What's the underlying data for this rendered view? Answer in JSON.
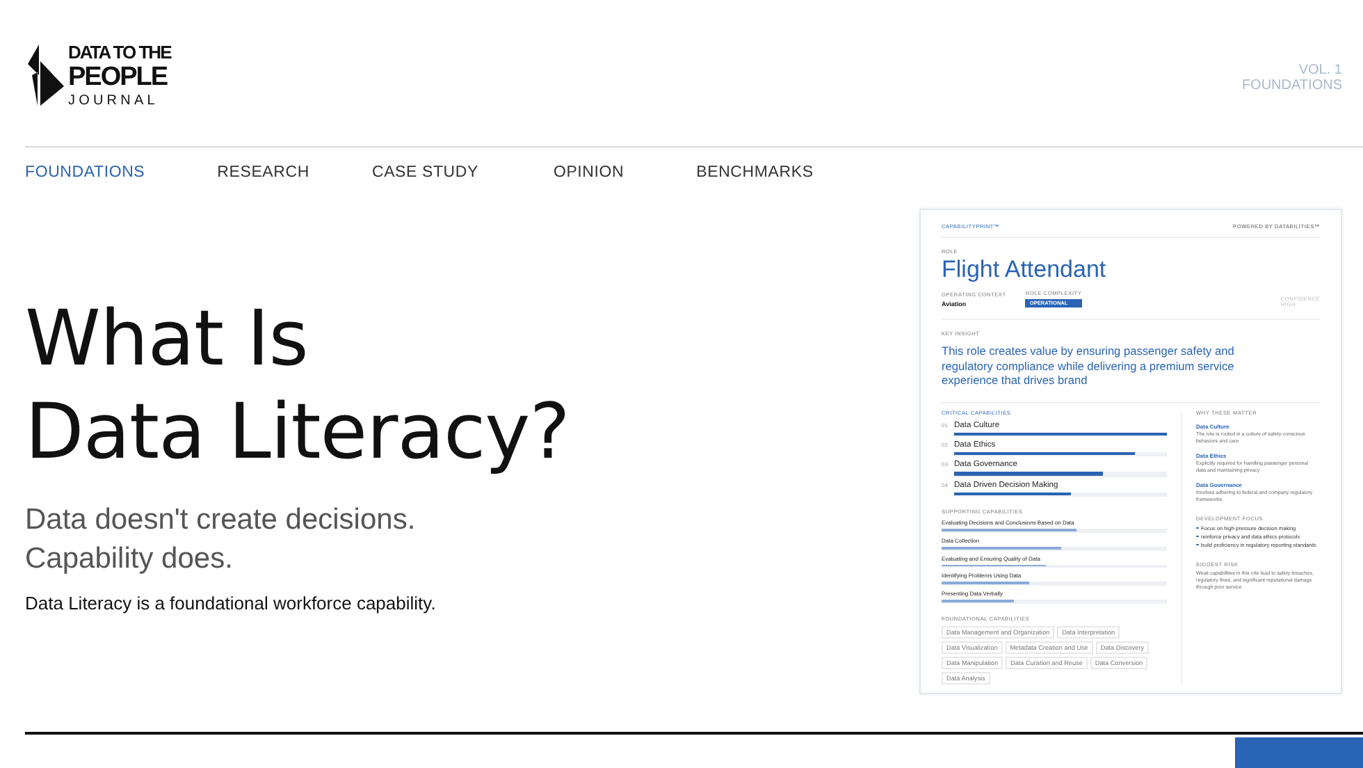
{
  "logo": {
    "line_1": "DATA TO THE",
    "line_2": "PEOPLE",
    "line_3": "JOURNAL"
  },
  "issue": {
    "volume": "VOL. 1",
    "section": "FOUNDATIONS"
  },
  "nav": [
    {
      "label": "FOUNDATIONS",
      "selected": true
    },
    {
      "label": "RESEARCH",
      "selected": false
    },
    {
      "label": "CASE STUDY",
      "selected": false
    },
    {
      "label": "OPINION",
      "selected": false
    },
    {
      "label": "BENCHMARKS",
      "selected": false
    }
  ],
  "hero": {
    "title_lines": [
      "What Is",
      "Data Literacy?"
    ],
    "subtitle_lines": [
      "Data doesn't create decisions.",
      "Capability does."
    ],
    "lead": "Data Literacy is a foundational workforce capability."
  },
  "card": {
    "brand": "CAPABILITYPRINT™",
    "powered_by": "POWERED BY DATABILITIES™",
    "role_label": "ROLE",
    "role": "Flight Attendant",
    "context_label": "OPERATING CONTEXT",
    "context": "Aviation",
    "complexity_label": "ROLE COMPLEXITY",
    "complexity": "OPERATIONAL",
    "confidence_label": "CONFIDENCE",
    "confidence": "HIGH",
    "insight_label": "KEY INSIGHT",
    "insight": "This role creates value by ensuring passenger safety and regulatory compliance while delivering a premium service experience that drives brand",
    "critical_label": "CRITICAL CAPABILITIES",
    "critical": [
      {
        "number": "01",
        "name": "Data Culture",
        "level": 1.0
      },
      {
        "number": "02",
        "name": "Data Ethics",
        "level": 0.85
      },
      {
        "number": "03",
        "name": "Data Governance",
        "level": 0.7
      },
      {
        "number": "04",
        "name": "Data Driven Decision Making",
        "level": 0.55
      }
    ],
    "supporting_label": "SUPPORTING CAPABILITIES",
    "supporting": [
      {
        "name": "Evaluating Decisions and Conclusions Based on Data",
        "level": 0.6
      },
      {
        "name": "Data Collection",
        "level": 0.53
      },
      {
        "name": "Evaluating and Ensuring Quality of Data",
        "level": 0.46
      },
      {
        "name": "Identifying Problems Using Data",
        "level": 0.39
      },
      {
        "name": "Presenting Data Verbally",
        "level": 0.32
      }
    ],
    "foundational_label": "FOUNDATIONAL CAPABILITIES",
    "foundational": [
      "Data Management and Organization",
      "Data Interpretation",
      "Data Visualization",
      "Metadata Creation and Use",
      "Data Discovery",
      "Data Manipulation",
      "Data Curation and Reuse",
      "Data Conversion",
      "Data Analysis"
    ],
    "why_label": "WHY THESE MATTER",
    "why": [
      {
        "title": "Data Culture",
        "text": "The role is rooted in a culture of safety-conscious behaviors and care"
      },
      {
        "title": "Data Ethics",
        "text": "Explicitly required for handling passenger personal data and maintaining privacy"
      },
      {
        "title": "Data Governance",
        "text": "Involves adhering to federal and company regulatory frameworks"
      }
    ],
    "development_label": "DEVELOPMENT FOCUS",
    "development": [
      "Focus on high-pressure decision making",
      "reinforce privacy and data ethics protocols",
      "build proficiency in regulatory reporting standards"
    ],
    "risk_label": "BIGGEST RISK",
    "risk": "Weak capabilities in this role lead to safety breaches, regulatory fines, and significant reputational damage through poor service"
  }
}
